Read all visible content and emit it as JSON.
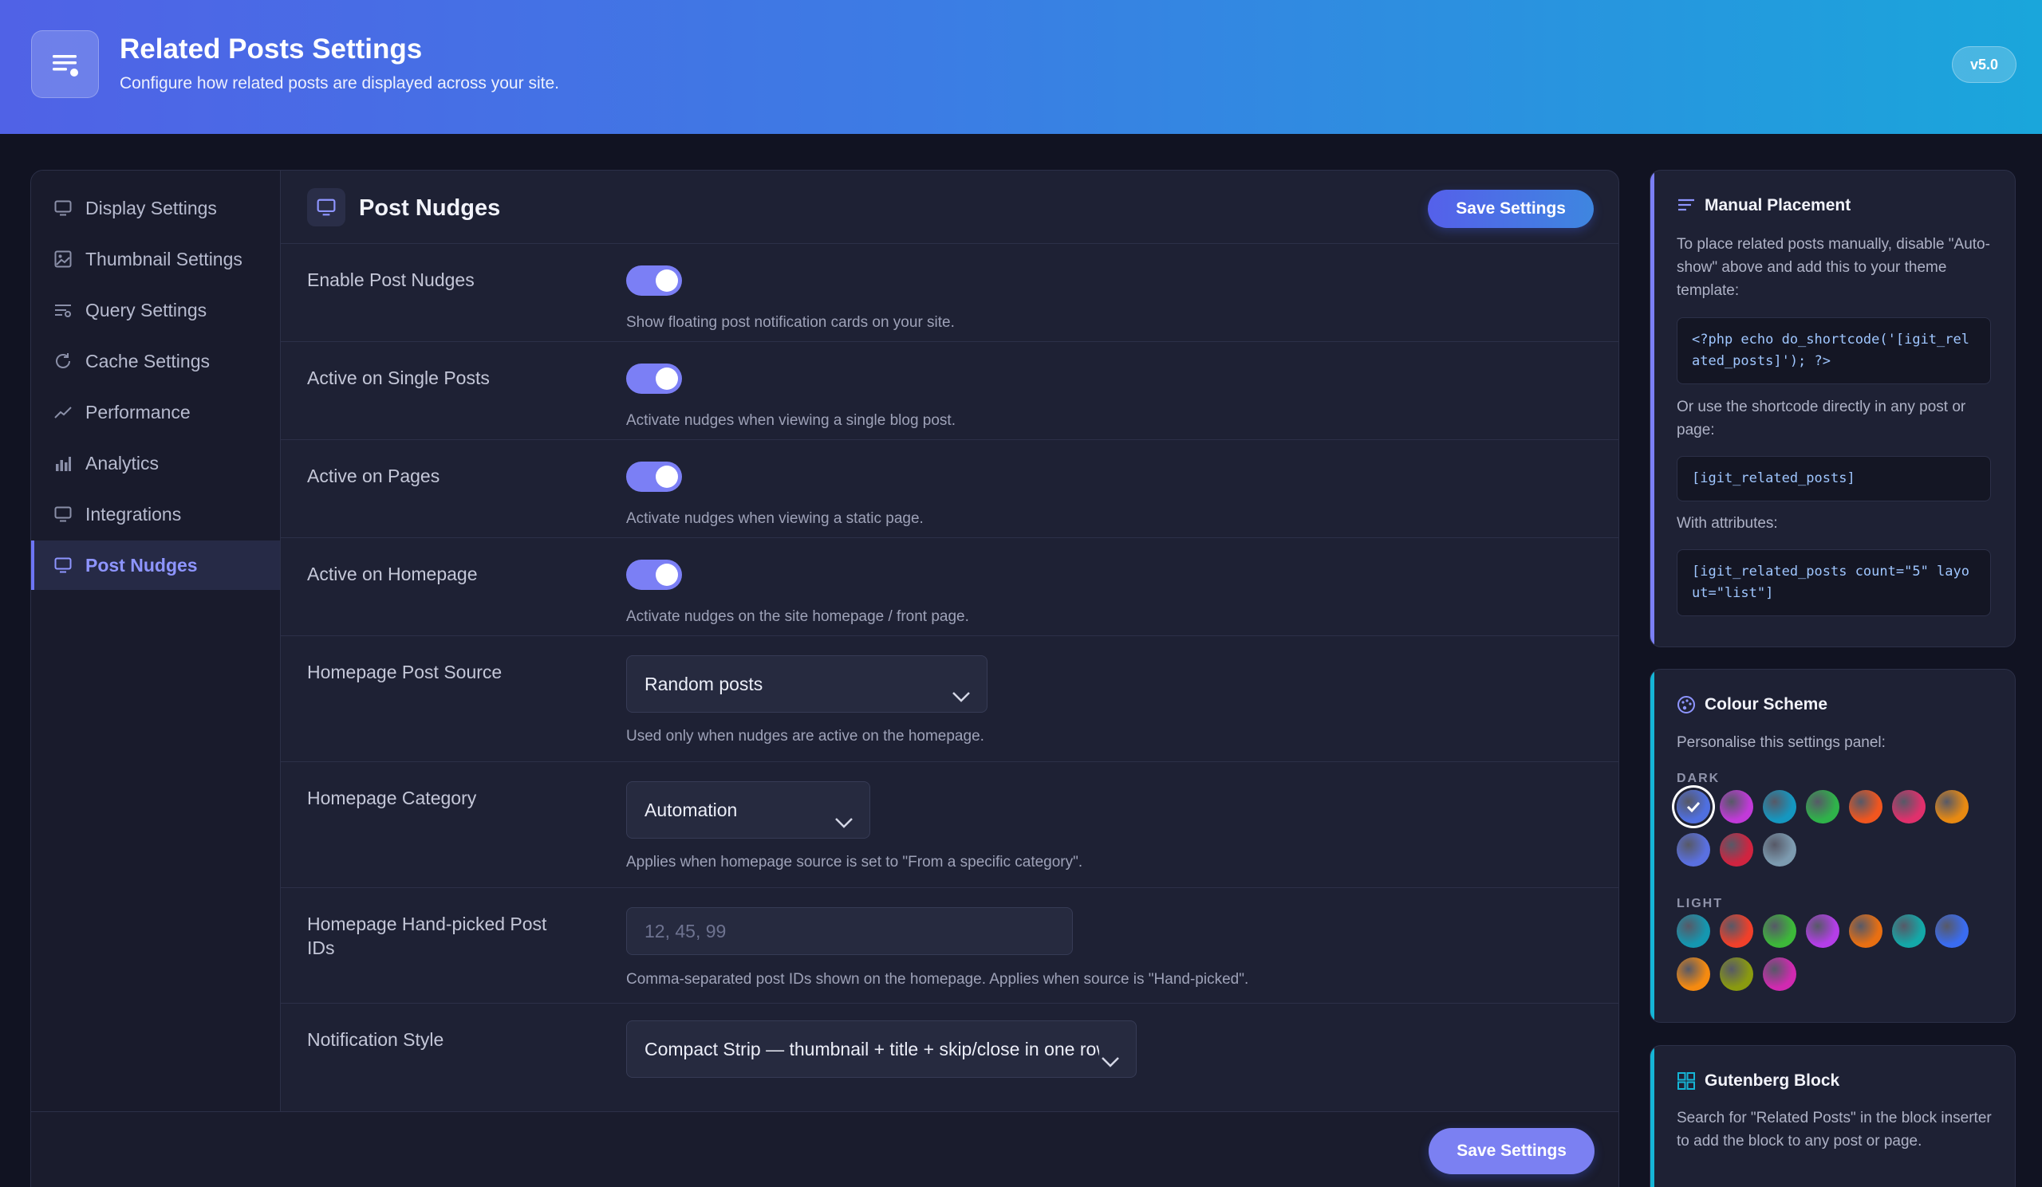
{
  "header": {
    "title": "Related Posts Settings",
    "subtitle": "Configure how related posts are displayed across your site.",
    "version": "v5.0"
  },
  "sidebar": {
    "items": [
      {
        "label": "Display Settings",
        "icon": "monitor-icon"
      },
      {
        "label": "Thumbnail Settings",
        "icon": "image-icon"
      },
      {
        "label": "Query Settings",
        "icon": "filter-list-icon"
      },
      {
        "label": "Cache Settings",
        "icon": "refresh-icon"
      },
      {
        "label": "Performance",
        "icon": "trend-icon"
      },
      {
        "label": "Analytics",
        "icon": "bar-chart-icon"
      },
      {
        "label": "Integrations",
        "icon": "monitor-icon"
      },
      {
        "label": "Post Nudges",
        "icon": "monitor-icon",
        "active": true
      }
    ]
  },
  "section": {
    "title": "Post Nudges",
    "save_label": "Save Settings",
    "rows": [
      {
        "label": "Enable Post Nudges",
        "help": "Show floating post notification cards on your site.",
        "on": true
      },
      {
        "label": "Active on Single Posts",
        "help": "Activate nudges when viewing a single blog post.",
        "on": true
      },
      {
        "label": "Active on Pages",
        "help": "Activate nudges when viewing a static page.",
        "on": true
      },
      {
        "label": "Active on Homepage",
        "help": "Activate nudges on the site homepage / front page.",
        "on": true
      }
    ],
    "source": {
      "label": "Homepage Post Source",
      "value": "Random posts",
      "help": "Used only when nudges are active on the homepage."
    },
    "category": {
      "label": "Homepage Category",
      "value": "Automation",
      "help": "Applies when homepage source is set to \"From a specific category\"."
    },
    "ids": {
      "label": "Homepage Hand-picked Post IDs",
      "placeholder": "12, 45, 99",
      "help": "Comma-separated post IDs shown on the homepage. Applies when source is \"Hand-picked\"."
    },
    "style": {
      "label": "Notification Style",
      "value": "Compact Strip — thumbnail + title + skip/close in one row"
    }
  },
  "footer": {
    "save_label": "Save Settings"
  },
  "manual": {
    "title": "Manual Placement",
    "intro": "To place related posts manually, disable \"Auto-show\" above and add this to your theme template:",
    "code1": "<?php echo do_shortcode('[igit_related_posts]'); ?>",
    "mid": "Or use the shortcode directly in any post or page:",
    "code2": "[igit_related_posts]",
    "attrs": "With attributes:",
    "code3": "[igit_related_posts count=\"5\" layout=\"list\"]"
  },
  "colour": {
    "title": "Colour Scheme",
    "intro": "Personalise this settings panel:",
    "dark_label": "DARK",
    "light_label": "LIGHT",
    "dark": [
      "#4f6fe0",
      "#c13ad8",
      "#1597c0",
      "#2fb34a",
      "#f0561f",
      "#e0306c",
      "#e88a12",
      "#5a70e0",
      "#d02440",
      "#7d9bb0"
    ],
    "light": [
      "#1597b0",
      "#f0402a",
      "#3db83a",
      "#b43ee8",
      "#e86f12",
      "#14a8a8",
      "#3a6cf0",
      "#f58a10",
      "#8a9a10",
      "#d02ab0"
    ]
  },
  "gutenberg": {
    "title": "Gutenberg Block",
    "text": "Search for \"Related Posts\" in the block inserter to add the block to any post or page."
  }
}
